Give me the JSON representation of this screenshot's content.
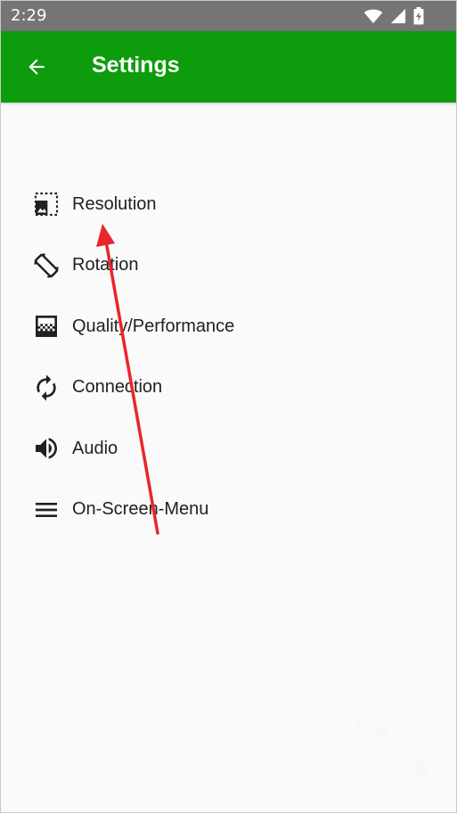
{
  "status_bar": {
    "time": "2:29",
    "icons": [
      "wifi-icon",
      "cellular-icon",
      "battery-charging-icon"
    ]
  },
  "app_bar": {
    "title": "Settings",
    "background_color": "#0c9c0c",
    "back_icon": "arrow-back-icon"
  },
  "menu": {
    "items": [
      {
        "label": "Resolution",
        "icon": "photo-size-select-icon"
      },
      {
        "label": "Rotation",
        "icon": "screen-rotation-icon"
      },
      {
        "label": "Quality/Performance",
        "icon": "gradient-icon"
      },
      {
        "label": "Connection",
        "icon": "autorenew-icon"
      },
      {
        "label": "Audio",
        "icon": "volume-up-icon"
      },
      {
        "label": "On-Screen-Menu",
        "icon": "menu-icon"
      }
    ]
  },
  "annotation": {
    "arrow_color": "#e8262b"
  },
  "watermark": {
    "text": "出色软件站"
  }
}
